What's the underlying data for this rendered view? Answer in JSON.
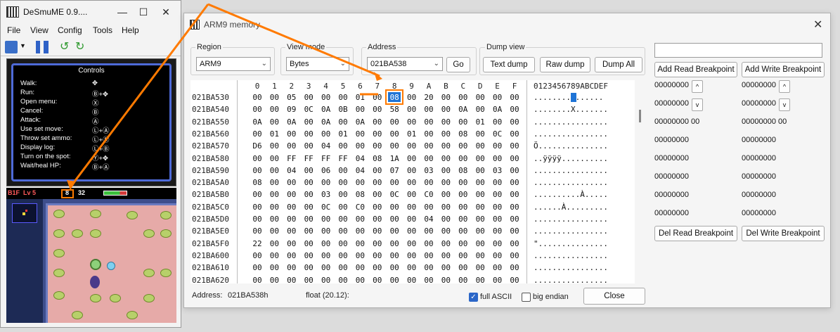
{
  "desmume": {
    "title": "DeSmuME 0.9....",
    "menu": [
      "File",
      "View",
      "Config",
      "Tools",
      "Help"
    ],
    "controls": {
      "title": "Controls",
      "rows": [
        {
          "label": "Walk:",
          "key": "✥"
        },
        {
          "label": "Run:",
          "key": "Ⓑ+✥"
        },
        {
          "label": "Open menu:",
          "key": "Ⓧ"
        },
        {
          "label": "Cancel:",
          "key": "Ⓑ"
        },
        {
          "label": "Attack:",
          "key": "Ⓐ"
        },
        {
          "label": "Use set move:",
          "key": "Ⓛ+Ⓐ"
        },
        {
          "label": "Throw set ammo:",
          "key": "Ⓛ+Ⓡ"
        },
        {
          "label": "Display log:",
          "key": "Ⓛ+Ⓑ"
        },
        {
          "label": "Turn on the spot:",
          "key": "Ⓨ+✥"
        },
        {
          "label": "Wait/heal HP:",
          "key": "Ⓑ+Ⓐ"
        }
      ]
    },
    "hud": {
      "floor_prefix": "B1F",
      "level": "Lv 5",
      "floor_value": "8",
      "hp": "32"
    }
  },
  "mem": {
    "title": "ARM9 memory",
    "region": {
      "label": "Region",
      "value": "ARM9"
    },
    "view_mode": {
      "label": "View mode",
      "value": "Bytes"
    },
    "address": {
      "label": "Address",
      "value": "021BA538",
      "go_label": "Go"
    },
    "dump": {
      "label": "Dump view",
      "text": "Text dump",
      "raw": "Raw dump",
      "all": "Dump All"
    },
    "hex": {
      "header": [
        "0",
        "1",
        "2",
        "3",
        "4",
        "5",
        "6",
        "7",
        "8",
        "9",
        "A",
        "B",
        "C",
        "D",
        "E",
        "F"
      ],
      "ascii_header": "0123456789ABCDEF",
      "rows": [
        {
          "addr": "021BA530",
          "bytes": [
            "00",
            "00",
            "05",
            "00",
            "00",
            "00",
            "01",
            "00",
            "08",
            "00",
            "20",
            "00",
            "00",
            "00",
            "00",
            "00"
          ],
          "ascii": "........ ......"
        },
        {
          "addr": "021BA540",
          "bytes": [
            "00",
            "00",
            "09",
            "0C",
            "0A",
            "0B",
            "00",
            "00",
            "58",
            "00",
            "00",
            "00",
            "0A",
            "00",
            "0A",
            "00"
          ],
          "ascii": "........X......."
        },
        {
          "addr": "021BA550",
          "bytes": [
            "0A",
            "00",
            "0A",
            "00",
            "0A",
            "00",
            "0A",
            "00",
            "00",
            "00",
            "00",
            "00",
            "00",
            "01",
            "00",
            "00"
          ],
          "ascii": "................"
        },
        {
          "addr": "021BA560",
          "bytes": [
            "00",
            "01",
            "00",
            "00",
            "00",
            "01",
            "00",
            "00",
            "00",
            "01",
            "00",
            "00",
            "08",
            "00",
            "0C",
            "00"
          ],
          "ascii": "................"
        },
        {
          "addr": "021BA570",
          "bytes": [
            "D6",
            "00",
            "00",
            "00",
            "04",
            "00",
            "00",
            "00",
            "00",
            "00",
            "00",
            "00",
            "00",
            "00",
            "00",
            "00"
          ],
          "ascii": "Ö..............."
        },
        {
          "addr": "021BA580",
          "bytes": [
            "00",
            "00",
            "FF",
            "FF",
            "FF",
            "FF",
            "04",
            "08",
            "1A",
            "00",
            "00",
            "00",
            "00",
            "00",
            "00",
            "00"
          ],
          "ascii": "..ÿÿÿÿ.........."
        },
        {
          "addr": "021BA590",
          "bytes": [
            "00",
            "00",
            "04",
            "00",
            "06",
            "00",
            "04",
            "00",
            "07",
            "00",
            "03",
            "00",
            "08",
            "00",
            "03",
            "00"
          ],
          "ascii": "................"
        },
        {
          "addr": "021BA5A0",
          "bytes": [
            "08",
            "00",
            "00",
            "00",
            "00",
            "00",
            "00",
            "00",
            "00",
            "00",
            "00",
            "00",
            "00",
            "00",
            "00",
            "00"
          ],
          "ascii": "................"
        },
        {
          "addr": "021BA5B0",
          "bytes": [
            "00",
            "00",
            "00",
            "00",
            "03",
            "00",
            "08",
            "00",
            "0C",
            "00",
            "C0",
            "00",
            "00",
            "00",
            "00",
            "00"
          ],
          "ascii": "..........À....."
        },
        {
          "addr": "021BA5C0",
          "bytes": [
            "00",
            "00",
            "00",
            "00",
            "0C",
            "00",
            "C0",
            "00",
            "00",
            "00",
            "00",
            "00",
            "00",
            "00",
            "00",
            "00"
          ],
          "ascii": "......À........."
        },
        {
          "addr": "021BA5D0",
          "bytes": [
            "00",
            "00",
            "00",
            "00",
            "00",
            "00",
            "00",
            "00",
            "00",
            "00",
            "04",
            "00",
            "00",
            "00",
            "00",
            "00"
          ],
          "ascii": "................"
        },
        {
          "addr": "021BA5E0",
          "bytes": [
            "00",
            "00",
            "00",
            "00",
            "00",
            "00",
            "00",
            "00",
            "00",
            "00",
            "00",
            "00",
            "00",
            "00",
            "00",
            "00"
          ],
          "ascii": "................"
        },
        {
          "addr": "021BA5F0",
          "bytes": [
            "22",
            "00",
            "00",
            "00",
            "00",
            "00",
            "00",
            "00",
            "00",
            "00",
            "00",
            "00",
            "00",
            "00",
            "00",
            "00"
          ],
          "ascii": "\"..............."
        },
        {
          "addr": "021BA600",
          "bytes": [
            "00",
            "00",
            "00",
            "00",
            "00",
            "00",
            "00",
            "00",
            "00",
            "00",
            "00",
            "00",
            "00",
            "00",
            "00",
            "00"
          ],
          "ascii": "................"
        },
        {
          "addr": "021BA610",
          "bytes": [
            "00",
            "00",
            "00",
            "00",
            "00",
            "00",
            "00",
            "00",
            "00",
            "00",
            "00",
            "00",
            "00",
            "00",
            "00",
            "00"
          ],
          "ascii": "................"
        },
        {
          "addr": "021BA620",
          "bytes": [
            "00",
            "00",
            "00",
            "00",
            "00",
            "00",
            "00",
            "00",
            "00",
            "00",
            "00",
            "00",
            "00",
            "00",
            "00",
            "00"
          ],
          "ascii": "................"
        }
      ]
    },
    "status": {
      "address_label": "Address:",
      "address_value": "021BA538h",
      "float_label": "float (20.12):",
      "full_ascii": "full ASCII",
      "big_endian": "big endian",
      "close": "Close"
    },
    "breakpoints": {
      "add_read": "Add Read Breakpoint",
      "add_write": "Add Write Breakpoint",
      "del_read": "Del Read Breakpoint",
      "del_write": "Del Write Breakpoint",
      "read_values": [
        "00000000",
        "00000000",
        "00000000 00",
        "00000000",
        "00000000",
        "00000000",
        "00000000",
        "00000000"
      ],
      "write_values": [
        "00000000",
        "00000000",
        "00000000 00",
        "00000000",
        "00000000",
        "00000000",
        "00000000",
        "00000000"
      ]
    }
  },
  "colors": {
    "annotation": "#ff7a00",
    "selection": "#1f74d6"
  }
}
